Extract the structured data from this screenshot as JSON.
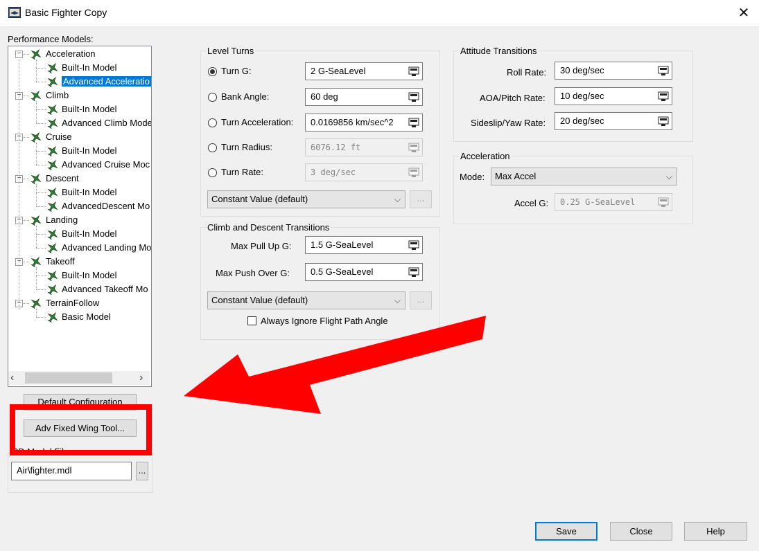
{
  "window": {
    "title": "Basic Fighter Copy",
    "close_glyph": "✕"
  },
  "performance_models": {
    "label": "Performance Models:",
    "tree": [
      {
        "label": "Acceleration",
        "children": [
          "Built-In Model",
          "Advanced Acceleratio"
        ],
        "selected": "Advanced Acceleratio"
      },
      {
        "label": "Climb",
        "children": [
          "Built-In Model",
          "Advanced Climb Mode"
        ]
      },
      {
        "label": "Cruise",
        "children": [
          "Built-In Model",
          "Advanced Cruise Moc"
        ]
      },
      {
        "label": "Descent",
        "children": [
          "Built-In Model",
          "AdvancedDescent Mo"
        ]
      },
      {
        "label": "Landing",
        "children": [
          "Built-In Model",
          "Advanced Landing Mo"
        ]
      },
      {
        "label": "Takeoff",
        "children": [
          "Built-In Model",
          "Advanced Takeoff Mo"
        ]
      },
      {
        "label": "TerrainFollow",
        "children": [
          "Basic Model"
        ]
      }
    ],
    "scroll_left": "‹",
    "scroll_right": "›"
  },
  "default_config_button": "Default Configuration",
  "adv_fixed_wing_button": "Adv Fixed Wing Tool...",
  "model_file": {
    "label": "3D Model File",
    "value": "Air\\fighter.mdl",
    "browse": "..."
  },
  "level_turns": {
    "title": "Level Turns",
    "options": [
      {
        "label": "Turn G:",
        "value": "2 G-SeaLevel",
        "selected": true,
        "enabled": true
      },
      {
        "label": "Bank Angle:",
        "value": "60 deg",
        "selected": false,
        "enabled": true
      },
      {
        "label": "Turn Acceleration:",
        "value": "0.0169856 km/sec^2",
        "selected": false,
        "enabled": true
      },
      {
        "label": "Turn Radius:",
        "value": "6076.12 ft",
        "selected": false,
        "enabled": false
      },
      {
        "label": "Turn Rate:",
        "value": "3 deg/sec",
        "selected": false,
        "enabled": false
      }
    ],
    "mode_combo": "Constant Value (default)",
    "more": "..."
  },
  "climb_descent": {
    "title": "Climb and Descent Transitions",
    "max_pull_up_label": "Max Pull Up G:",
    "max_pull_up_value": "1.5 G-SeaLevel",
    "max_push_over_label": "Max Push Over G:",
    "max_push_over_value": "0.5 G-SeaLevel",
    "mode_combo": "Constant Value (default)",
    "more": "...",
    "ignore_fpa_label": "Always Ignore Flight Path Angle",
    "ignore_fpa_checked": false
  },
  "attitude": {
    "title": "Attitude Transitions",
    "roll_label": "Roll Rate:",
    "roll_value": "30 deg/sec",
    "aoa_label": "AOA/Pitch Rate:",
    "aoa_value": "10 deg/sec",
    "sideslip_label": "Sideslip/Yaw Rate:",
    "sideslip_value": "20 deg/sec"
  },
  "acceleration": {
    "title": "Acceleration",
    "mode_label": "Mode:",
    "mode_value": "Max Accel",
    "accel_g_label": "Accel G:",
    "accel_g_value": "0.25 G-SeaLevel"
  },
  "footer": {
    "save": "Save",
    "close": "Close",
    "help": "Help"
  },
  "colors": {
    "selection": "#0078d7",
    "annotation_red": "#ff0000",
    "plane_green": "#2e7d32"
  }
}
